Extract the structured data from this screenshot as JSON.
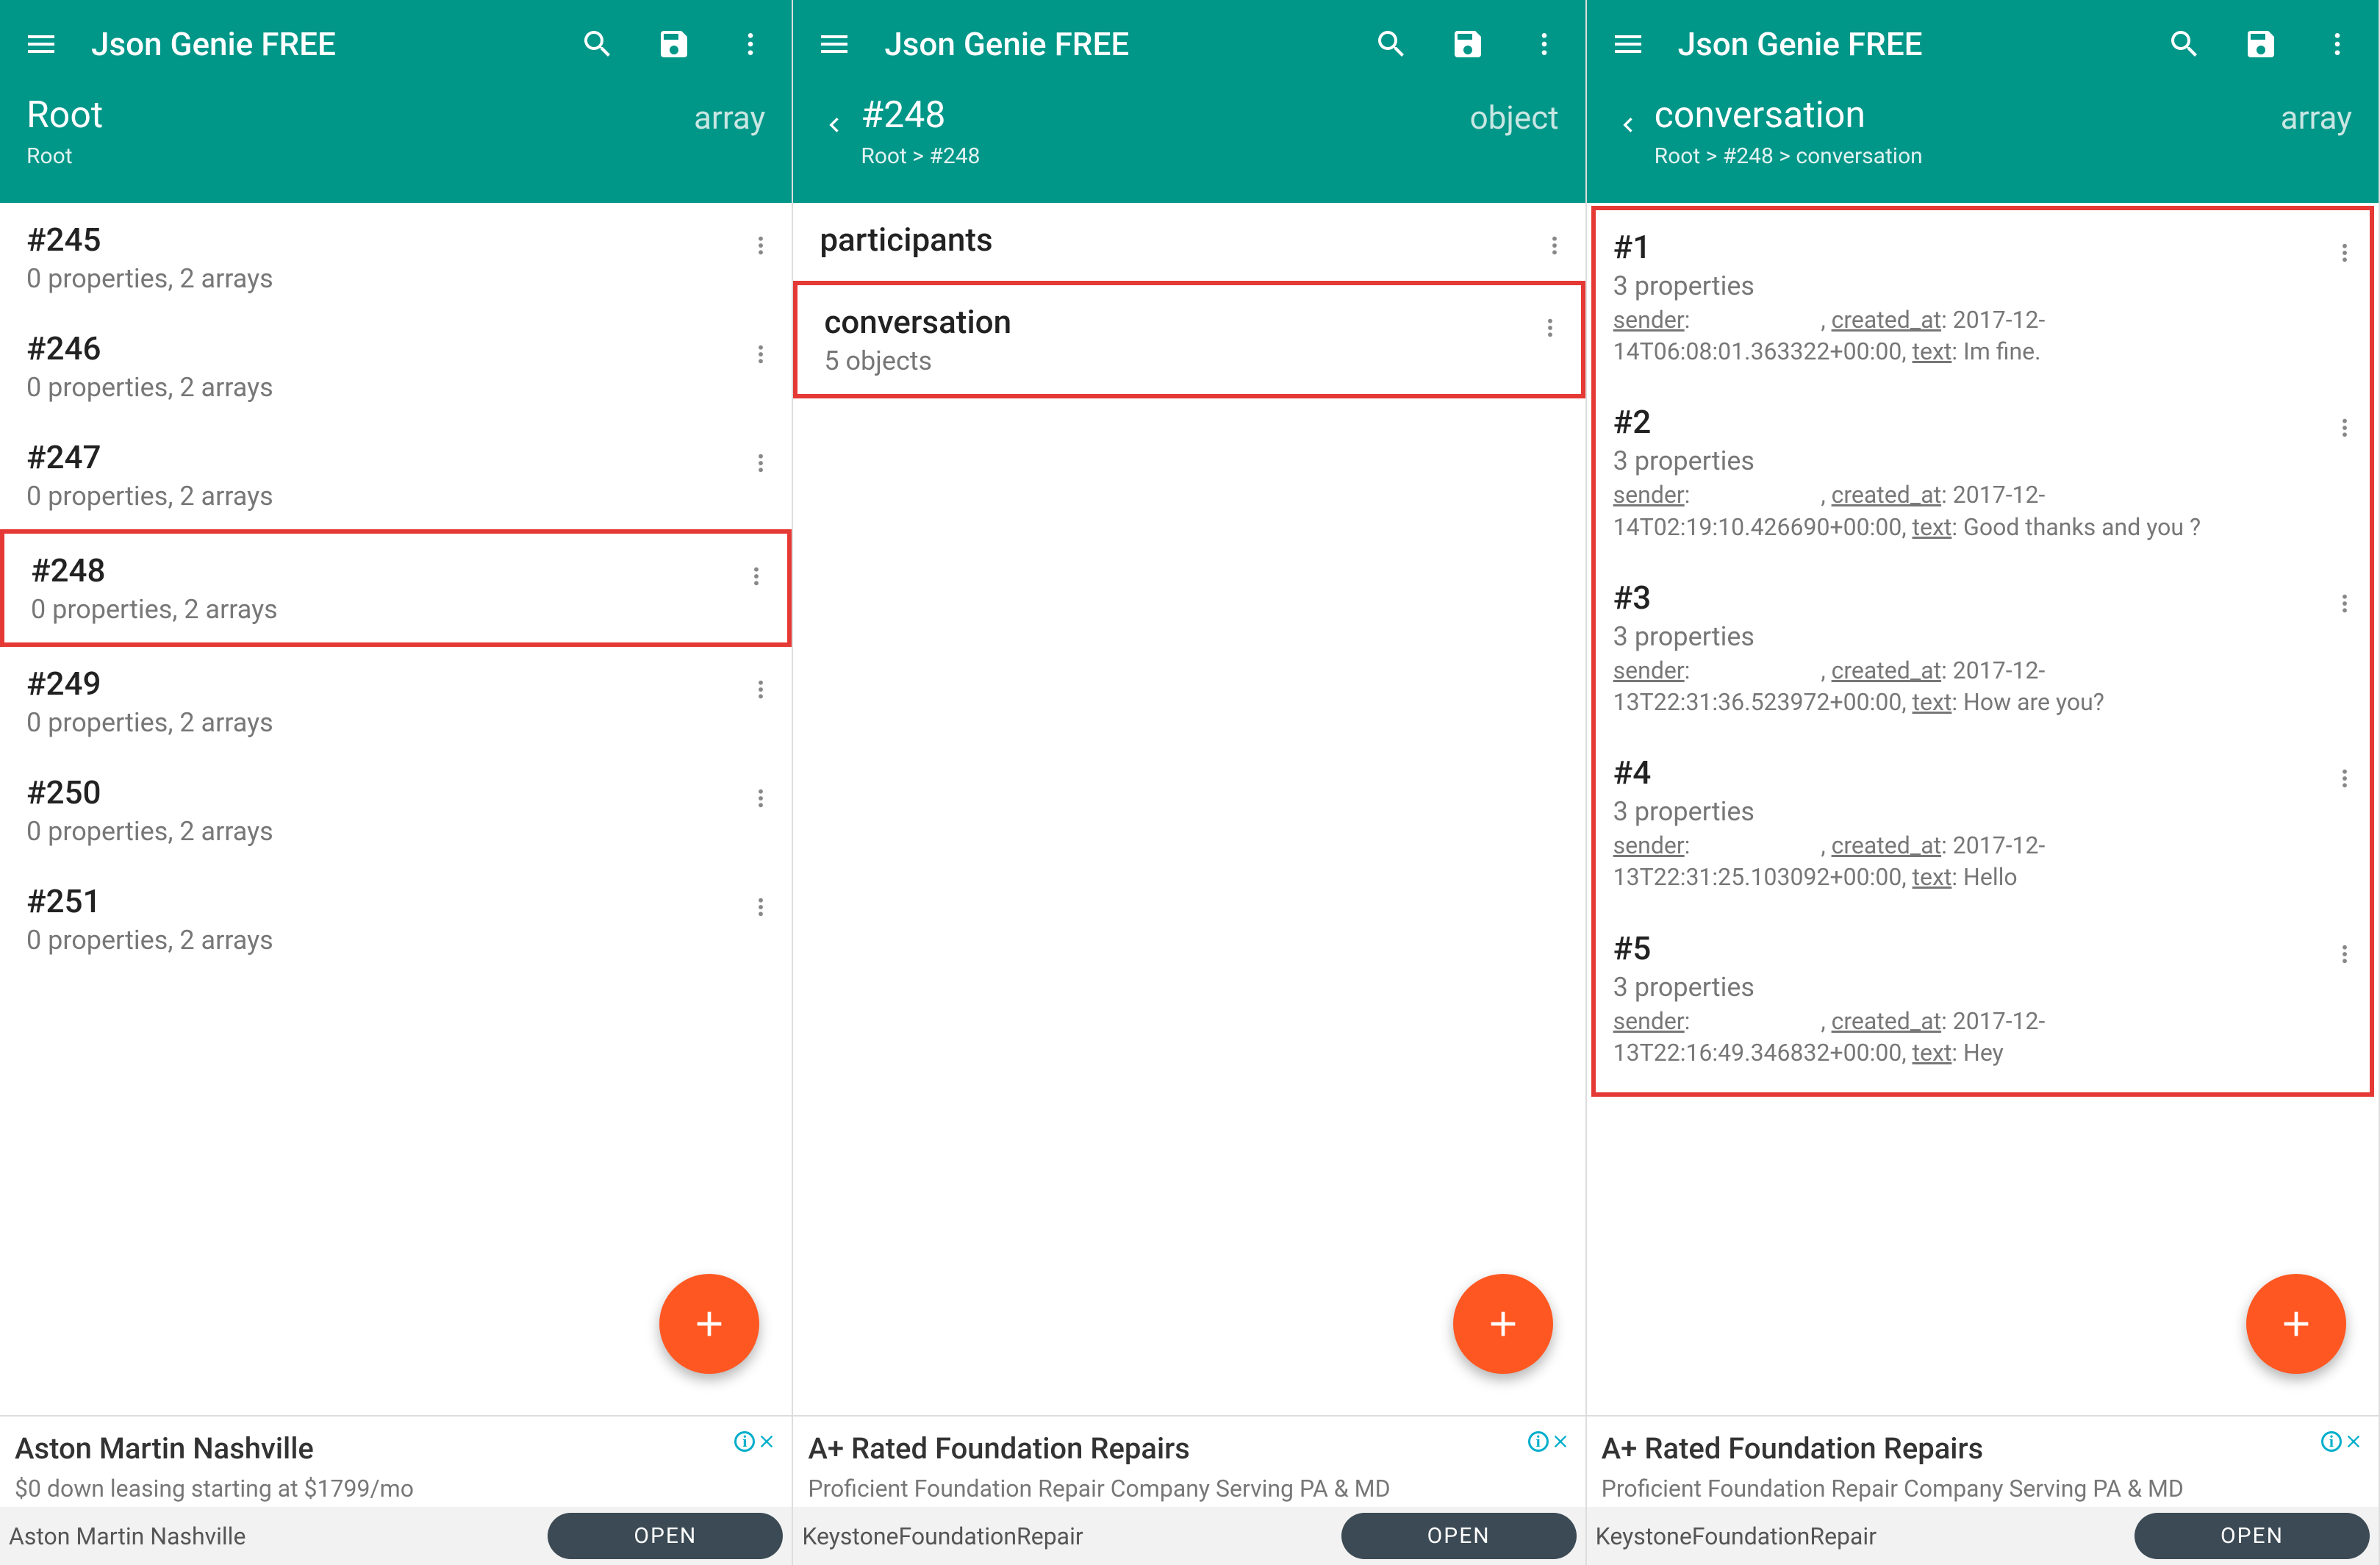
{
  "app_title": "Json Genie FREE",
  "colors": {
    "primary": "#009688",
    "accent": "#ff5722",
    "highlight": "#e53935"
  },
  "pane1": {
    "node_title": "Root",
    "breadcrumb": "Root",
    "type_label": "array",
    "items": [
      {
        "title": "#245",
        "sub": "0 properties, 2 arrays"
      },
      {
        "title": "#246",
        "sub": "0 properties, 2 arrays"
      },
      {
        "title": "#247",
        "sub": "0 properties, 2 arrays"
      },
      {
        "title": "#248",
        "sub": "0 properties, 2 arrays",
        "highlight": true
      },
      {
        "title": "#249",
        "sub": "0 properties, 2 arrays"
      },
      {
        "title": "#250",
        "sub": "0 properties, 2 arrays"
      },
      {
        "title": "#251",
        "sub": "0 properties, 2 arrays"
      }
    ],
    "ad": {
      "headline": "Aston Martin Nashville",
      "tagline": "$0 down leasing starting at $1799/mo",
      "advertiser": "Aston Martin Nashville",
      "button": "OPEN"
    }
  },
  "pane2": {
    "node_title": "#248",
    "breadcrumb": "Root > #248",
    "type_label": "object",
    "items": [
      {
        "title": "participants",
        "sub": ""
      },
      {
        "title": "conversation",
        "sub": "5 objects",
        "highlight": true
      }
    ],
    "ad": {
      "headline": "A+ Rated Foundation Repairs",
      "tagline": "Proficient Foundation Repair Company Serving PA & MD",
      "advertiser": "KeystoneFoundationRepair",
      "button": "OPEN"
    }
  },
  "pane3": {
    "node_title": "conversation",
    "breadcrumb": "Root > #248 > conversation",
    "type_label": "array",
    "items": [
      {
        "title": "#1",
        "sub": "3 properties",
        "detail": {
          "created_at": "2017-12-14T06:08:01.363322+00:00",
          "text": "Im fine."
        }
      },
      {
        "title": "#2",
        "sub": "3 properties",
        "detail": {
          "created_at": "2017-12-14T02:19:10.426690+00:00",
          "text": "Good thanks and you ?"
        }
      },
      {
        "title": "#3",
        "sub": "3 properties",
        "detail": {
          "created_at": "2017-12-13T22:31:36.523972+00:00",
          "text": "How are you?"
        }
      },
      {
        "title": "#4",
        "sub": "3 properties",
        "detail": {
          "created_at": "2017-12-13T22:31:25.103092+00:00",
          "text": "Hello"
        }
      },
      {
        "title": "#5",
        "sub": "3 properties",
        "detail": {
          "created_at": "2017-12-13T22:16:49.346832+00:00",
          "text": "Hey"
        }
      }
    ],
    "ad": {
      "headline": "A+ Rated Foundation Repairs",
      "tagline": "Proficient Foundation Repair Company Serving PA & MD",
      "advertiser": "KeystoneFoundationRepair",
      "button": "OPEN"
    }
  },
  "labels": {
    "sender_key": "sender",
    "created_key": "created_at",
    "text_key": "text"
  }
}
